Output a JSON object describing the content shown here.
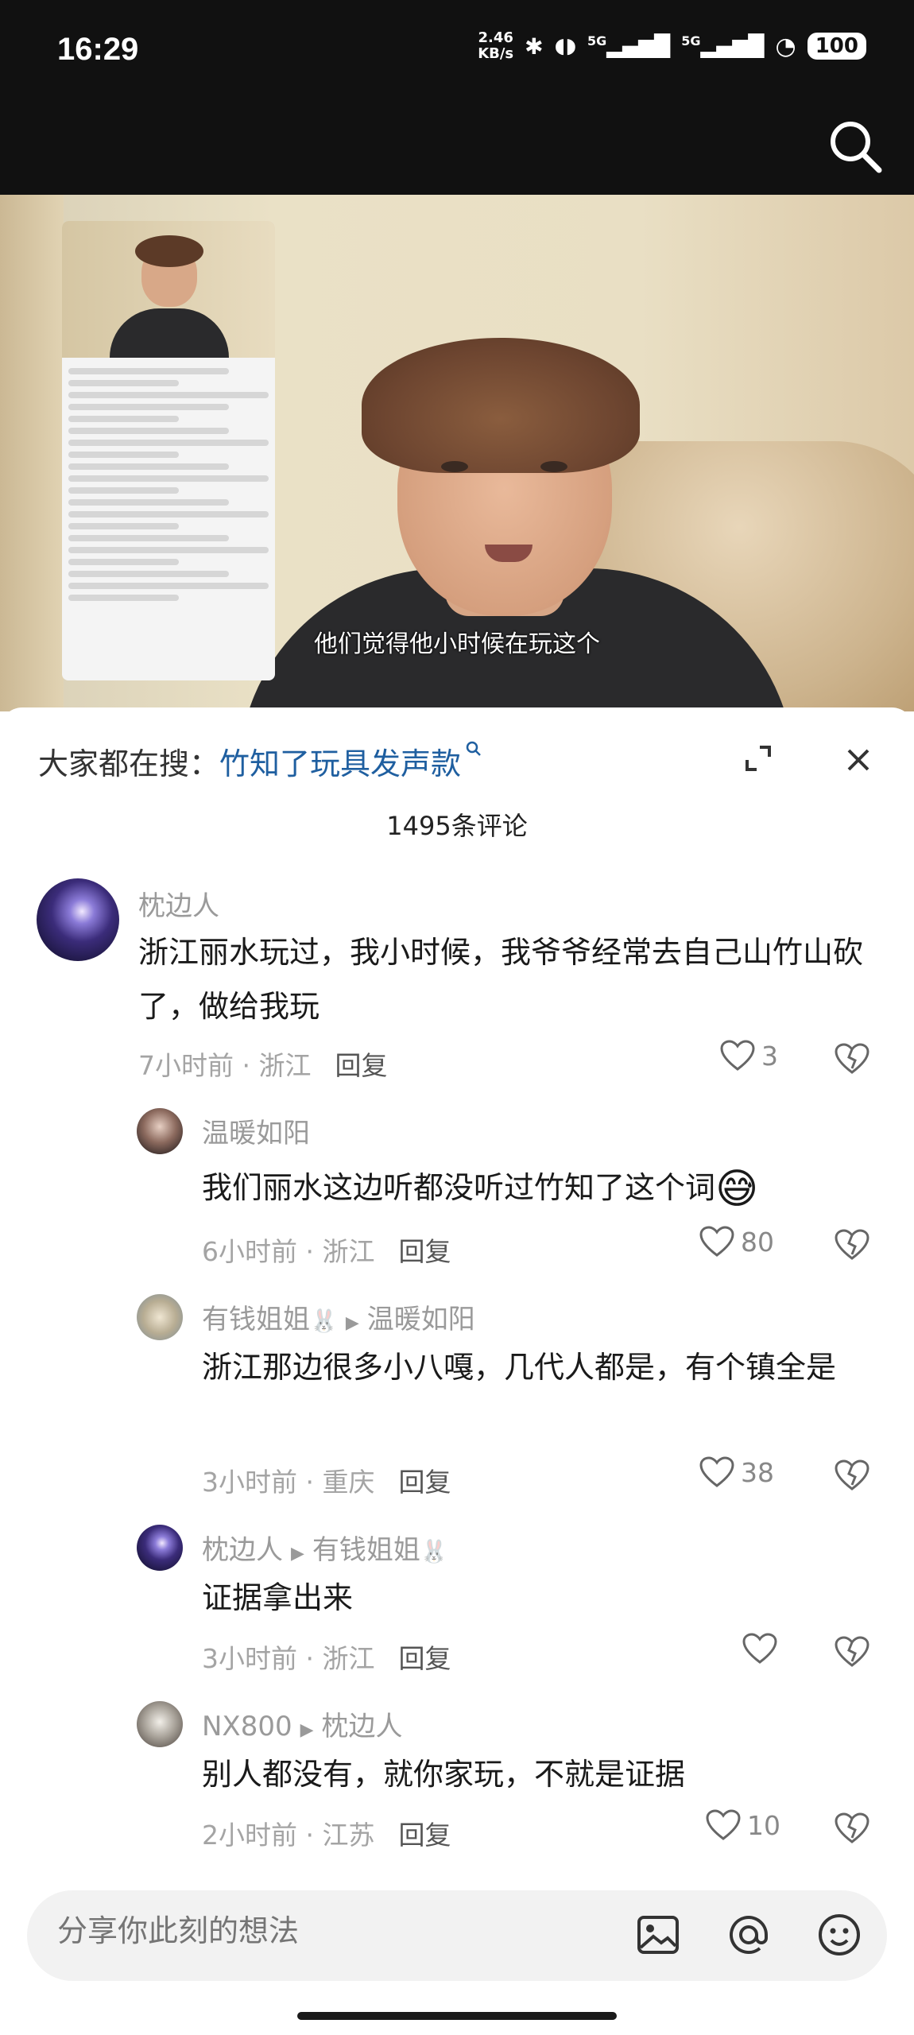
{
  "status": {
    "time": "16:29",
    "net_speed": "2.46",
    "net_unit": "KB/s",
    "sig1": "5G",
    "sig2": "5G",
    "battery": "100"
  },
  "video": {
    "subtitle": "他们觉得他小时候在玩这个"
  },
  "sheet": {
    "search_prefix": "大家都在搜：",
    "search_keyword": "竹知了玩具发声款",
    "comment_count": "1495条评论"
  },
  "comments": [
    {
      "name": "枕边人",
      "text": "浙江丽水玩过，我小时候，我爷爷经常去自己山竹山砍了，做给我玩",
      "time": "7小时前",
      "location": "浙江",
      "reply_label": "回复",
      "likes": "3"
    },
    {
      "name": "温暖如阳",
      "text": "我们丽水这边听都没听过竹知了这个词",
      "emoji": "😅",
      "time": "6小时前",
      "location": "浙江",
      "reply_label": "回复",
      "likes": "80"
    },
    {
      "name": "有钱姐姐",
      "name_suffix": "🐰",
      "reply_to": "温暖如阳",
      "text": "浙江那边很多小八嘎，几代人都是，有个镇全是",
      "time": "3小时前",
      "location": "重庆",
      "reply_label": "回复",
      "likes": "38"
    },
    {
      "name": "枕边人",
      "reply_to": "有钱姐姐",
      "reply_to_suffix": "🐰",
      "text": "证据拿出来",
      "time": "3小时前",
      "location": "浙江",
      "reply_label": "回复",
      "likes": ""
    },
    {
      "name": "NX800",
      "reply_to": "枕边人",
      "text": "别人都没有，就你家玩，不就是证据",
      "time": "2小时前",
      "location": "江苏",
      "reply_label": "回复",
      "likes": "10"
    }
  ],
  "composer": {
    "placeholder": "分享你此刻的想法"
  },
  "icons": {
    "search": "search-icon",
    "expand": "expand-icon",
    "close": "close-icon",
    "like": "heart-icon",
    "dislike": "broken-heart-icon",
    "image": "image-icon",
    "mention": "at-icon",
    "emoji": "emoji-icon"
  }
}
